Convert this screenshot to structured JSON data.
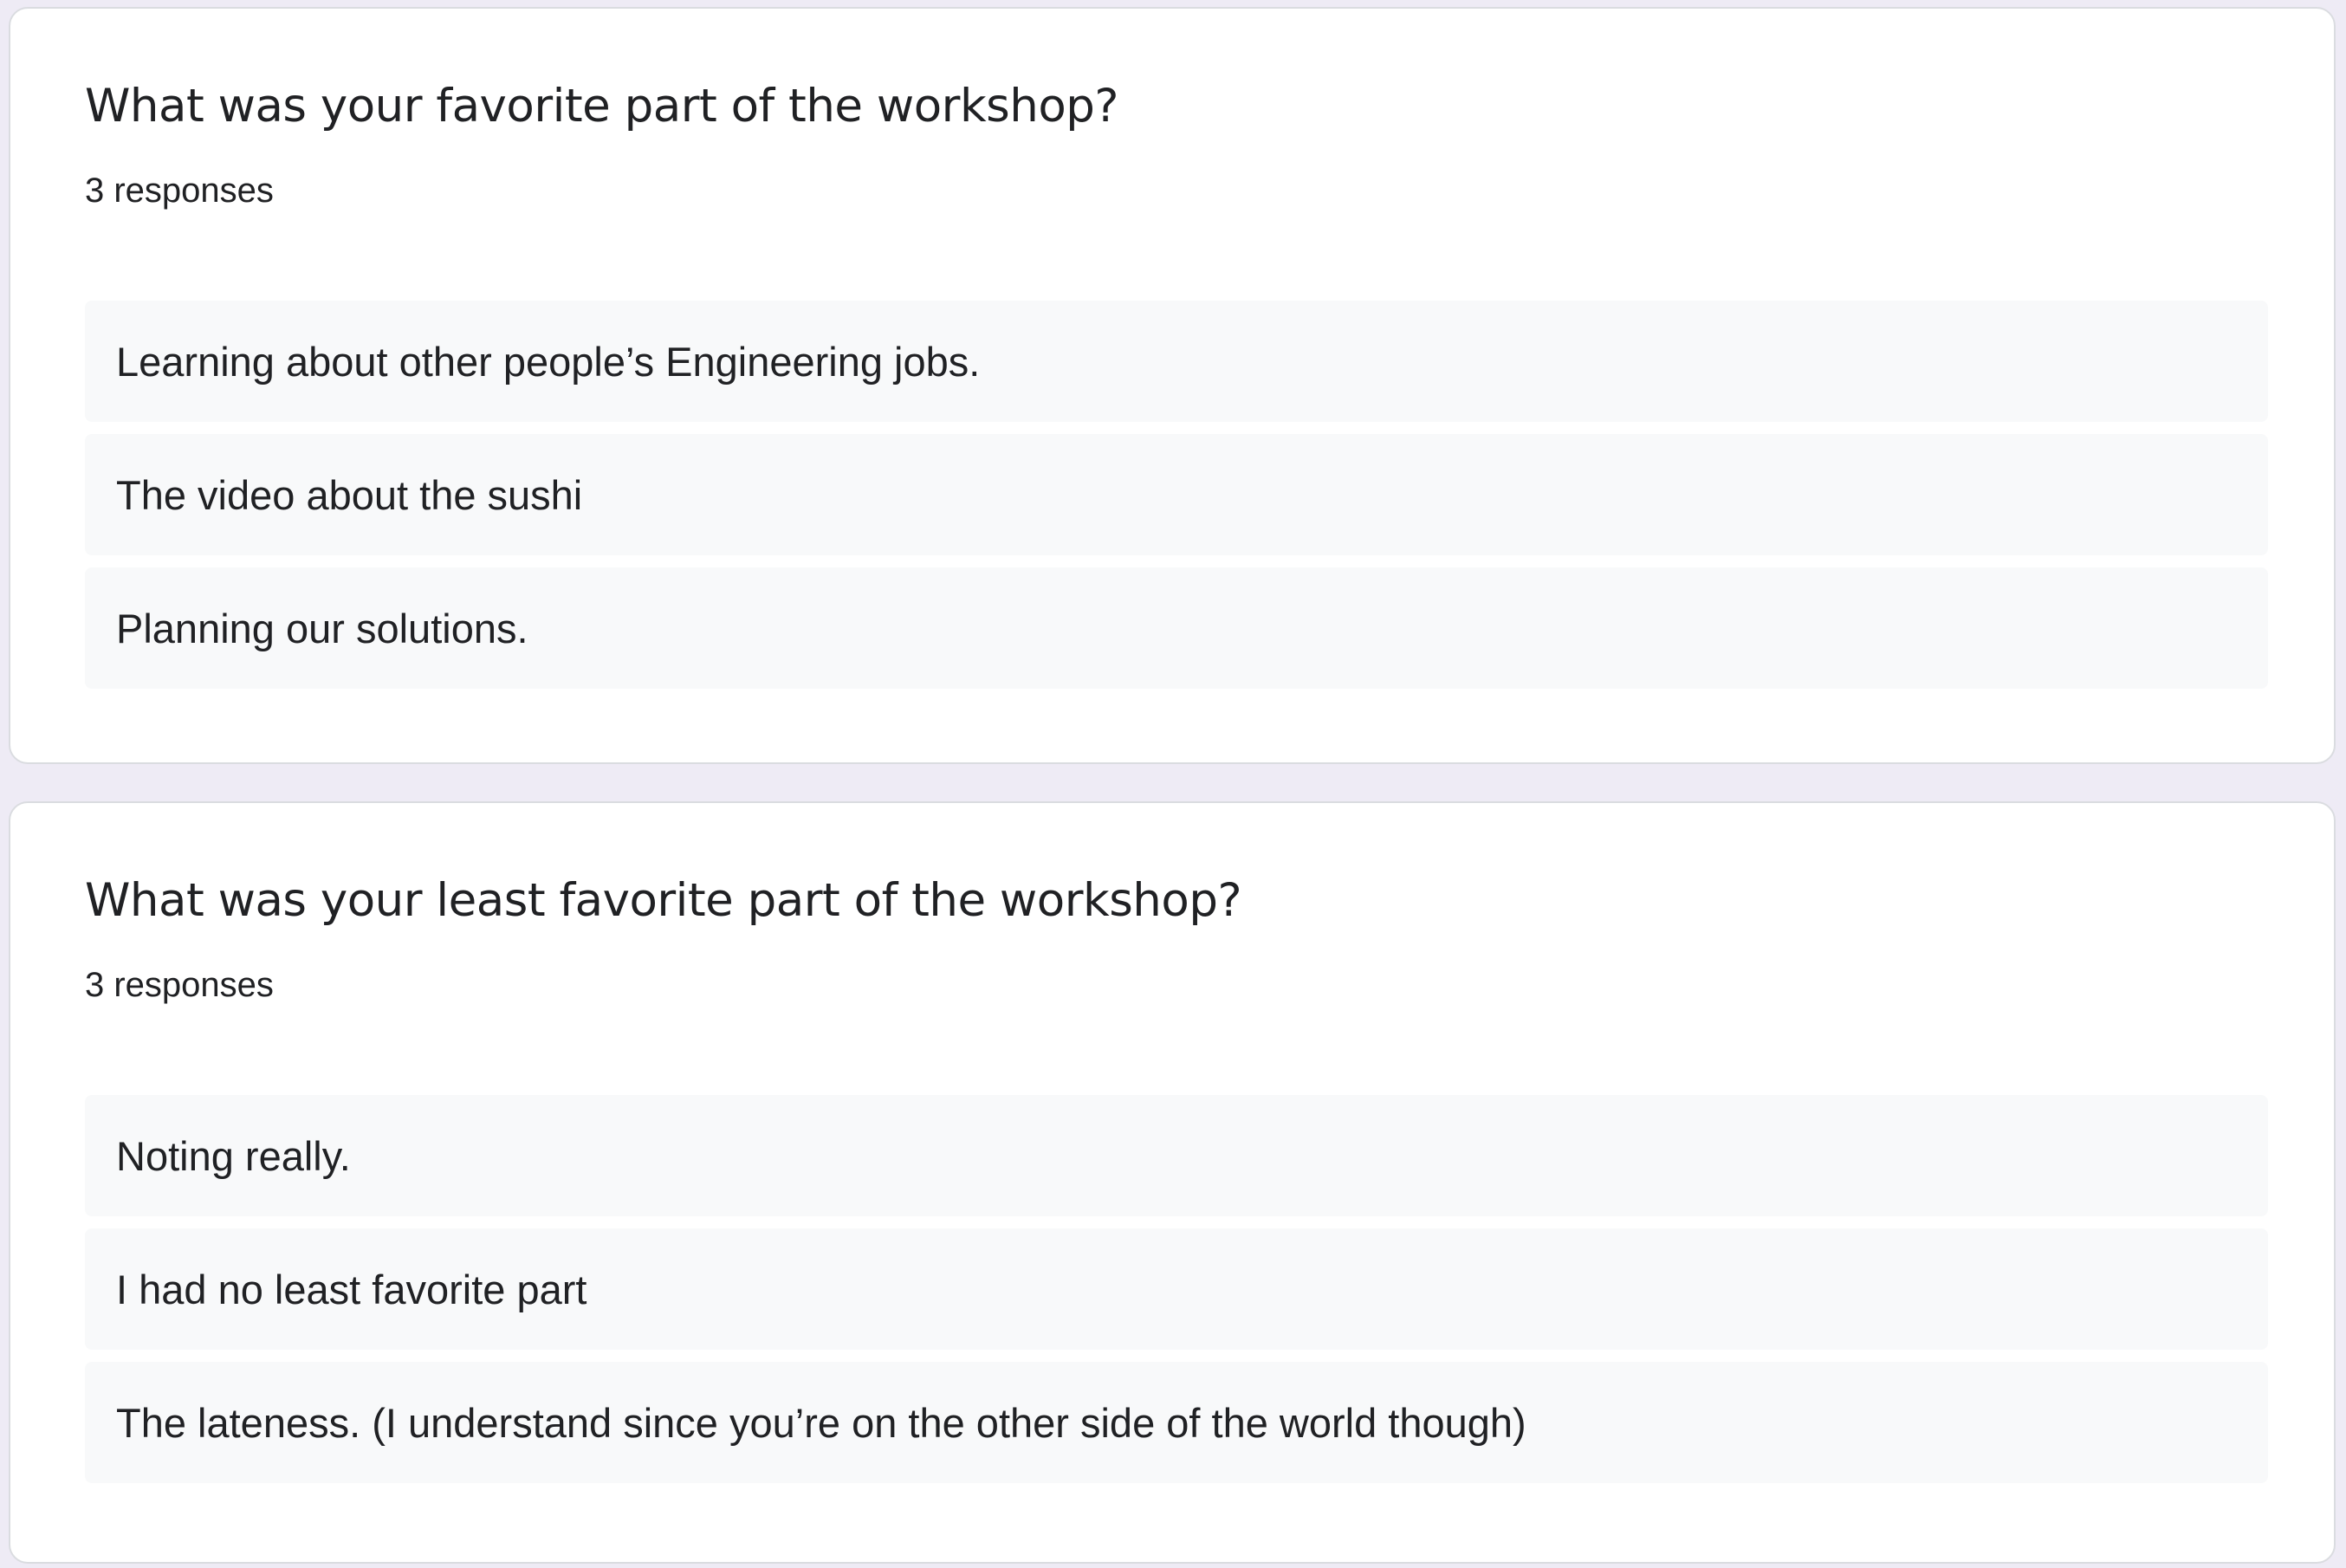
{
  "questions": [
    {
      "title": "What was your favorite part of the workshop?",
      "count": "3 responses",
      "responses": [
        "Learning about other people’s Engineering jobs.",
        "The video about the sushi",
        "Planning our solutions."
      ]
    },
    {
      "title": "What was your least favorite part of the workshop?",
      "count": "3 responses",
      "responses": [
        "Noting really.",
        "I had no least favorite part",
        "The lateness. (I understand since you’re on the other side of the world though)"
      ]
    }
  ],
  "colors": {
    "page_background": "#eeebf5",
    "card_background": "#ffffff",
    "response_background": "#f8f9fa",
    "text": "#202124"
  }
}
